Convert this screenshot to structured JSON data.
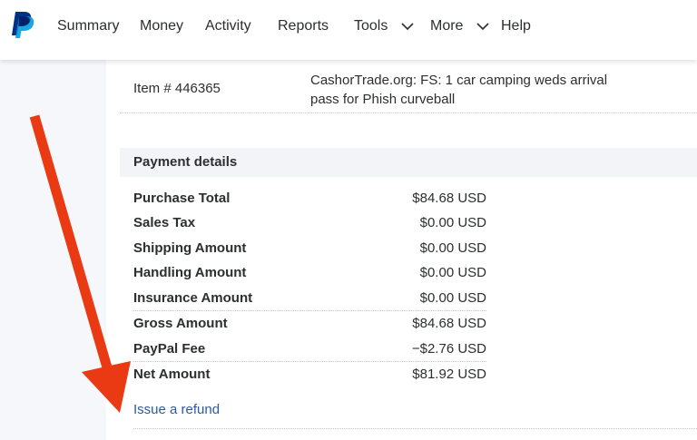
{
  "nav": {
    "items": [
      {
        "label": "Summary"
      },
      {
        "label": "Money"
      },
      {
        "label": "Activity"
      },
      {
        "label": "Reports"
      },
      {
        "label": "Tools"
      },
      {
        "label": "More"
      },
      {
        "label": "Help"
      }
    ],
    "logo_icon": "paypal-logo-icon",
    "dropdown_icon": "chevron-down-icon"
  },
  "item": {
    "label": "Item # 446365",
    "description": "CashorTrade.org: FS: 1 car camping weds arrival pass for Phish curveball"
  },
  "payment_details": {
    "title": "Payment details",
    "rows": [
      {
        "label": "Purchase Total",
        "value": "$84.68 USD"
      },
      {
        "label": "Sales Tax",
        "value": "$0.00 USD"
      },
      {
        "label": "Shipping Amount",
        "value": "$0.00 USD"
      },
      {
        "label": "Handling Amount",
        "value": "$0.00 USD"
      },
      {
        "label": "Insurance Amount",
        "value": "$0.00 USD"
      },
      {
        "label": "Gross Amount",
        "value": "$84.68 USD"
      },
      {
        "label": "PayPal Fee",
        "value": "−$2.76 USD"
      },
      {
        "label": "Net Amount",
        "value": "$81.92 USD"
      }
    ],
    "refund_link": "Issue a refund"
  },
  "colors": {
    "link": "#2c5aa0",
    "annotation_arrow": "#ea3a14",
    "paypal_dark": "#003087",
    "paypal_light": "#009cde"
  }
}
